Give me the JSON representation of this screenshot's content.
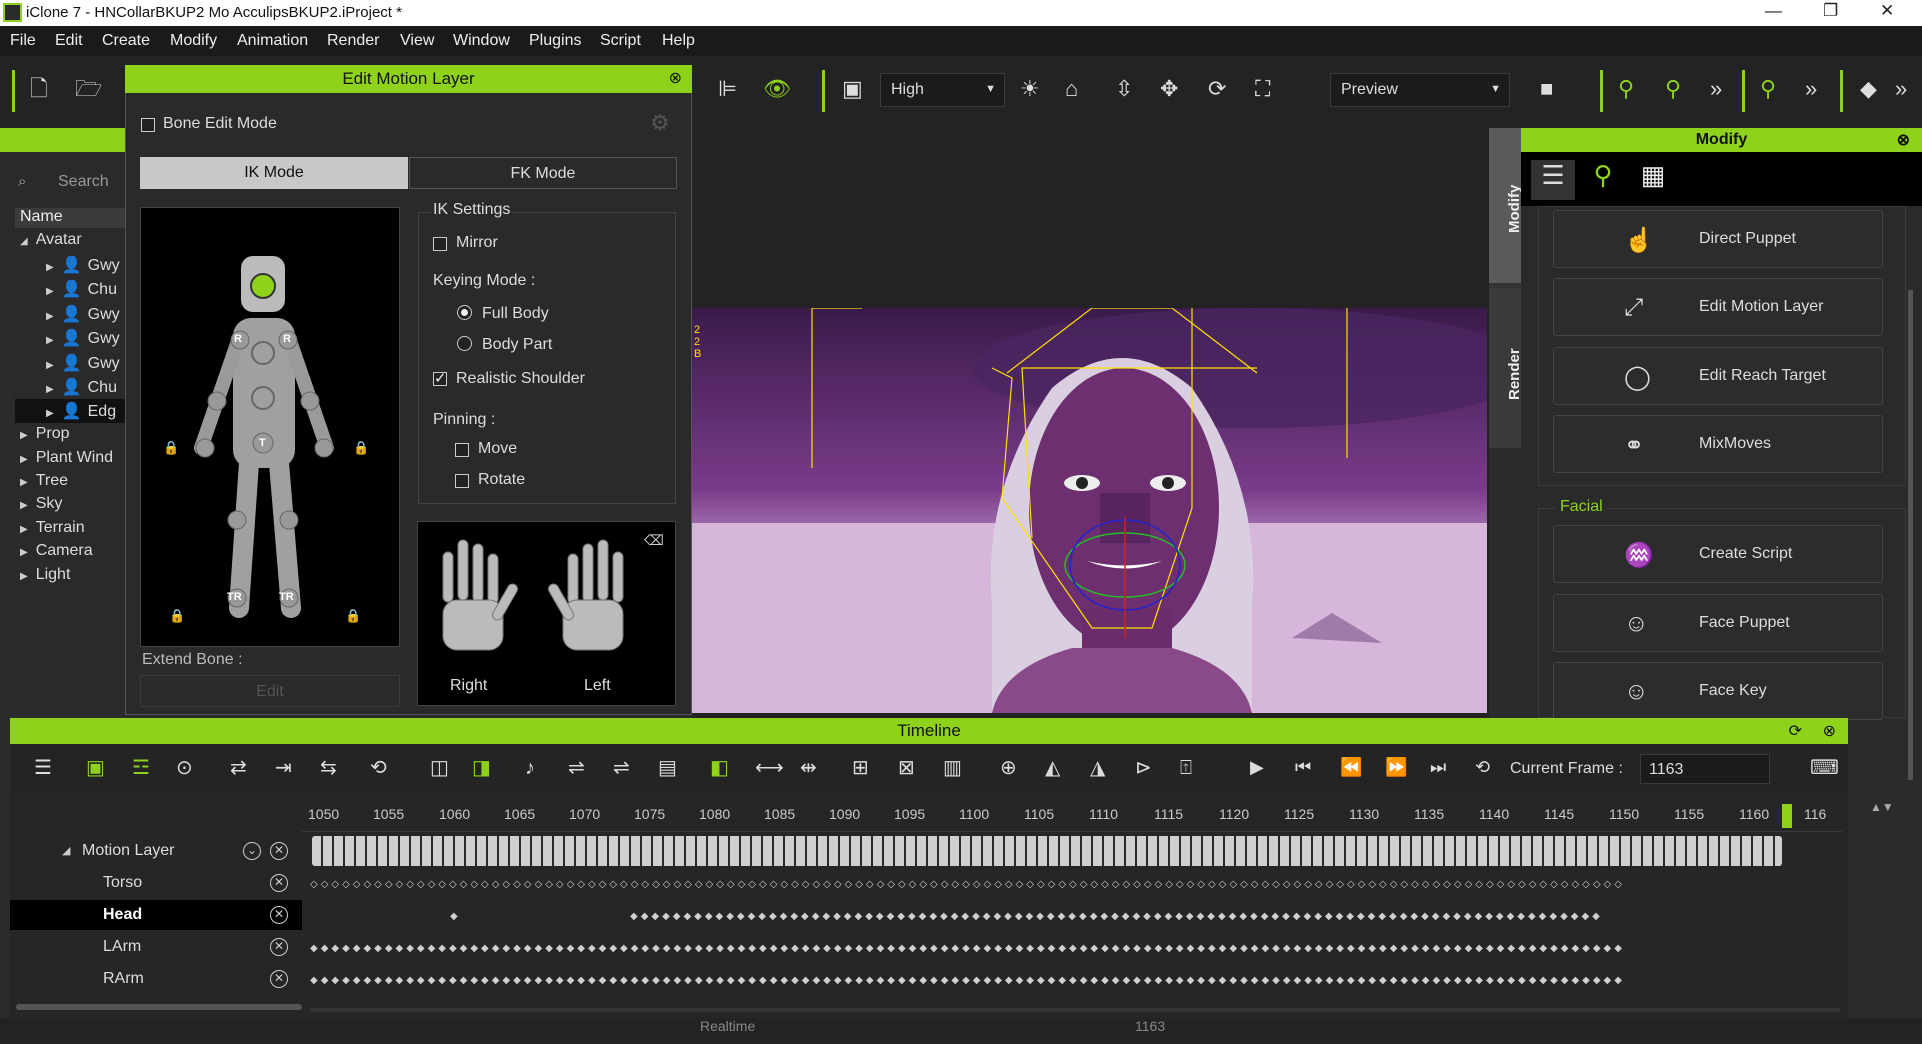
{
  "window": {
    "title": "iClone 7 - HNCollarBKUP2 Mo AcculipsBKUP2.iProject *"
  },
  "menu": [
    "File",
    "Edit",
    "Create",
    "Modify",
    "Animation",
    "Render",
    "View",
    "Window",
    "Plugins",
    "Script",
    "Help"
  ],
  "toolbar": {
    "quality": "High",
    "render_mode": "Preview"
  },
  "scene_panel": {
    "search_placeholder": "Search",
    "name_header": "Name",
    "items": [
      "Avatar",
      "Gwy",
      "Chu",
      "Gwy",
      "Gwy",
      "Gwy",
      "Chu",
      "Edg",
      "Prop",
      "Plant Wind",
      "Tree",
      "Sky",
      "Terrain",
      "Camera",
      "Light"
    ]
  },
  "edit_motion_layer": {
    "title": "Edit Motion Layer",
    "bone_edit_mode": "Bone Edit Mode",
    "tabs": [
      "IK Mode",
      "FK Mode"
    ],
    "ik_settings": "IK Settings",
    "mirror": "Mirror",
    "keying_mode": "Keying Mode :",
    "full_body": "Full Body",
    "body_part": "Body Part",
    "realistic_shoulder": "Realistic Shoulder",
    "pinning": "Pinning :",
    "move": "Move",
    "rotate": "Rotate",
    "extend_bone": "Extend Bone :",
    "edit_button": "Edit",
    "right_hand": "Right",
    "left_hand": "Left",
    "joint_labels": {
      "r": "R",
      "t": "T",
      "tr": "TR"
    }
  },
  "viewport": {
    "overlay_digits": [
      "2",
      "2",
      "B"
    ]
  },
  "side_tabs": [
    "Modify",
    "Render"
  ],
  "modify_panel": {
    "title": "Modify",
    "buttons": [
      "Direct Puppet",
      "Edit Motion Layer",
      "Edit Reach Target",
      "MixMoves"
    ],
    "facial_label": "Facial",
    "facial_buttons": [
      "Create Script",
      "Face Puppet",
      "Face Key"
    ]
  },
  "timeline": {
    "title": "Timeline",
    "current_frame_label": "Current Frame :",
    "current_frame": "1163",
    "ticks": [
      "1050",
      "1055",
      "1060",
      "1065",
      "1070",
      "1075",
      "1080",
      "1085",
      "1090",
      "1095",
      "1100",
      "1105",
      "1110",
      "1115",
      "1120",
      "1125",
      "1130",
      "1135",
      "1140",
      "1145",
      "1150",
      "1155",
      "1160",
      "116"
    ],
    "tracks": [
      "Motion Layer",
      "Torso",
      "Head",
      "LArm",
      "RArm"
    ],
    "bottom_hidden": [
      "Realtime",
      "1163"
    ]
  }
}
